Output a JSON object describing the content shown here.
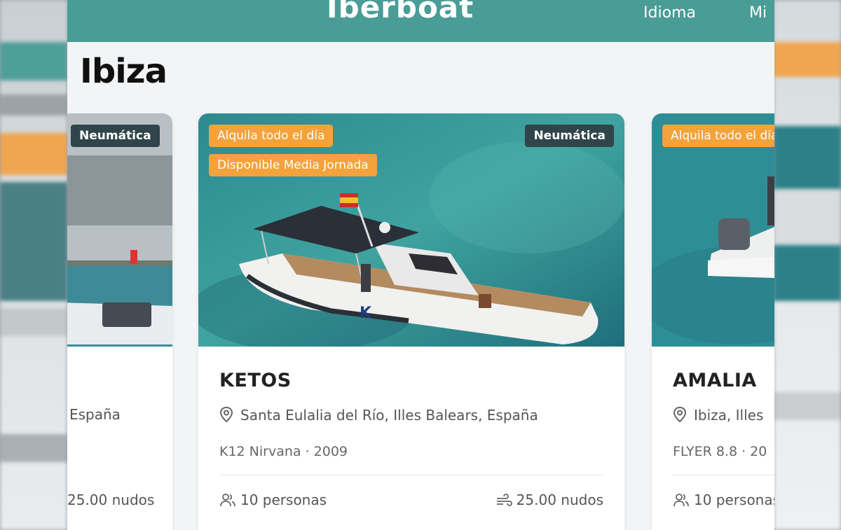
{
  "header": {
    "brand": "Iberboat",
    "nav_language": "Idioma",
    "nav_my": "Mi"
  },
  "page": {
    "title": "Ibiza"
  },
  "cards": [
    {
      "type_badge": "Neumática",
      "location": "España",
      "speed": "25.00 nudos"
    },
    {
      "tags": [
        "Alquila todo el día",
        "Disponible Media Jornada"
      ],
      "type_badge": "Neumática",
      "name": "KETOS",
      "location": "Santa Eulalia del Río, Illes Balears, España",
      "model": "K12 Nirvana · 2009",
      "capacity": "10 personas",
      "speed": "25.00 nudos"
    },
    {
      "tags": [
        "Alquila todo el día"
      ],
      "name": "AMALIA",
      "location": "Ibiza, Illes",
      "model": "FLYER 8.8 · 20",
      "capacity": "10 personas"
    }
  ],
  "colors": {
    "header": "#4a9c96",
    "tag_orange": "#f4a23c",
    "badge_dark": "#2f4549"
  },
  "icons": [
    "location-pin-icon",
    "people-icon",
    "wind-speed-icon"
  ]
}
